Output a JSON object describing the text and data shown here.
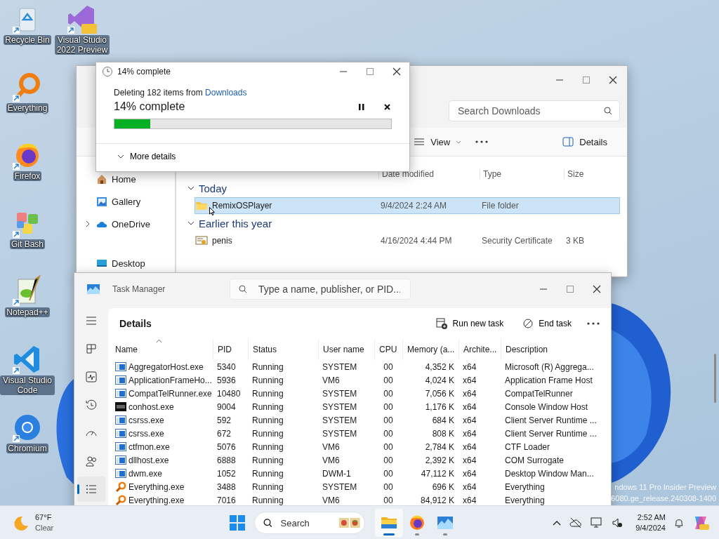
{
  "desktop_icons": [
    {
      "label": "Recycle Bin"
    },
    {
      "label": "Everything"
    },
    {
      "label": "Firefox"
    },
    {
      "label": "Git Bash"
    },
    {
      "label": "Notepad++"
    },
    {
      "label": "Visual Studio Code"
    },
    {
      "label": "Chromium"
    },
    {
      "label": "Visual Studio 2022 Preview"
    }
  ],
  "explorer": {
    "search": {
      "placeholder": "Search Downloads"
    },
    "toolbar": [
      {
        "label": "View",
        "kind": "view"
      },
      {
        "label": "Details",
        "kind": "details"
      }
    ],
    "sidebar": {
      "items": [
        {
          "label": "Home",
          "expandable": false
        },
        {
          "label": "Gallery",
          "expandable": false
        },
        {
          "label": "OneDrive",
          "expandable": true
        },
        {
          "label": "Desktop",
          "expandable": false
        }
      ]
    },
    "columns": [
      "Date modified",
      "Type",
      "Size"
    ],
    "groups": [
      {
        "title": "Today",
        "expanded": true,
        "items": [
          {
            "name": "RemixOSPlayer",
            "kind": "folder",
            "date": "9/4/2024 2:24 AM",
            "type": "File folder",
            "selected": true
          }
        ]
      },
      {
        "title": "Earlier this year",
        "expanded": true,
        "items": [
          {
            "name": "penis",
            "kind": "certificate",
            "date": "4/16/2024 4:44 PM",
            "type": "Security Certificate",
            "size": "3 KB",
            "selected": false
          }
        ]
      }
    ]
  },
  "copy_dialog": {
    "title": "14% complete",
    "message": "Deleting 182 items from",
    "source": "Downloads",
    "status": "14% complete",
    "level": 0.13,
    "more": "More details"
  },
  "task_manager": {
    "title": "Task Manager",
    "search": {
      "placeholder": "Type a name, publisher, or PID..."
    },
    "nav_items": [
      {
        "selected": false
      },
      {
        "selected": false
      },
      {
        "selected": false
      },
      {
        "selected": false
      },
      {
        "selected": false
      },
      {
        "selected": false
      },
      {
        "selected": true
      }
    ],
    "page_title": "Details",
    "actions": [
      {
        "label": "Run new task",
        "kind": "run"
      },
      {
        "label": "End task",
        "kind": "end"
      }
    ],
    "columns": [
      "Name",
      "PID",
      "Status",
      "User name",
      "CPU",
      "Memory (a...",
      "Archite...",
      "Description"
    ],
    "rows": [
      {
        "kind": "window",
        "cells": [
          "AggregatorHost.exe",
          "5340",
          "Running",
          "SYSTEM",
          "00",
          "4,352 K",
          "x64",
          "Microsoft (R) Aggrega..."
        ]
      },
      {
        "kind": "window",
        "cells": [
          "ApplicationFrameHo...",
          "5936",
          "Running",
          "VM6",
          "00",
          "4,024 K",
          "x64",
          "Application Frame Host"
        ]
      },
      {
        "kind": "window",
        "cells": [
          "CompatTelRunner.exe",
          "10480",
          "Running",
          "SYSTEM",
          "00",
          "7,056 K",
          "x64",
          "CompatTelRunner"
        ]
      },
      {
        "kind": "console",
        "cells": [
          "conhost.exe",
          "9004",
          "Running",
          "SYSTEM",
          "00",
          "1,176 K",
          "x64",
          "Console Window Host"
        ]
      },
      {
        "kind": "window",
        "cells": [
          "csrss.exe",
          "592",
          "Running",
          "SYSTEM",
          "00",
          "684 K",
          "x64",
          "Client Server Runtime ..."
        ]
      },
      {
        "kind": "window",
        "cells": [
          "csrss.exe",
          "672",
          "Running",
          "SYSTEM",
          "00",
          "808 K",
          "x64",
          "Client Server Runtime ..."
        ]
      },
      {
        "kind": "window",
        "cells": [
          "ctfmon.exe",
          "5076",
          "Running",
          "VM6",
          "00",
          "2,784 K",
          "x64",
          "CTF Loader"
        ]
      },
      {
        "kind": "window",
        "cells": [
          "dllhost.exe",
          "6888",
          "Running",
          "VM6",
          "00",
          "2,392 K",
          "x64",
          "COM Surrogate"
        ]
      },
      {
        "kind": "window",
        "cells": [
          "dwm.exe",
          "1052",
          "Running",
          "DWM-1",
          "00",
          "47,112 K",
          "x64",
          "Desktop Window Man..."
        ]
      },
      {
        "kind": "magnifier",
        "cells": [
          "Everything.exe",
          "3488",
          "Running",
          "SYSTEM",
          "00",
          "696 K",
          "x64",
          "Everything"
        ]
      },
      {
        "kind": "magnifier",
        "cells": [
          "Everything.exe",
          "7016",
          "Running",
          "VM6",
          "00",
          "84,912 K",
          "x64",
          "Everything"
        ]
      }
    ]
  },
  "build_text": [
    "ndows 11 Pro Insider Preview",
    "6080.ge_release.240308-1400"
  ],
  "taskbar": {
    "weather": {
      "temperature": "67°F",
      "condition": "Clear"
    },
    "search": {
      "placeholder": "Search"
    },
    "apps": [
      {
        "active": true
      },
      {
        "active": false
      },
      {
        "active": false
      }
    ],
    "time": "2:52 AM",
    "date": "9/4/2024"
  }
}
